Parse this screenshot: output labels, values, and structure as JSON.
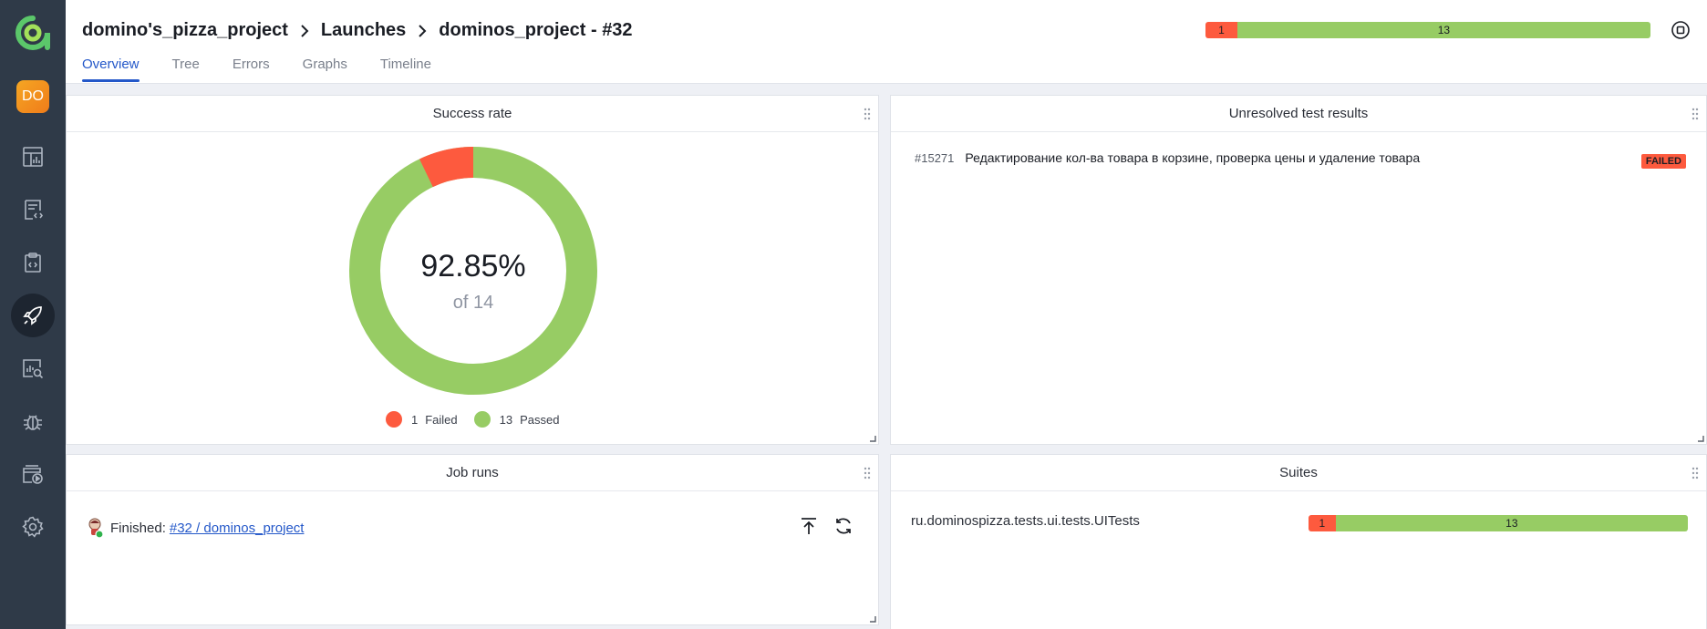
{
  "sidebar": {
    "avatar_initials": "DO",
    "items": [
      {
        "icon": "dashboard-icon",
        "active": false
      },
      {
        "icon": "test-cases-icon",
        "active": false
      },
      {
        "icon": "test-plans-icon",
        "active": false
      },
      {
        "icon": "launches-icon",
        "active": true
      },
      {
        "icon": "analytics-icon",
        "active": false
      },
      {
        "icon": "defects-icon",
        "active": false
      },
      {
        "icon": "jobs-icon",
        "active": false
      },
      {
        "icon": "settings-icon",
        "active": false
      }
    ]
  },
  "header": {
    "breadcrumb": [
      "domino's_pizza_project",
      "Launches",
      "dominos_project - #32"
    ],
    "tabs": [
      "Overview",
      "Tree",
      "Errors",
      "Graphs",
      "Timeline"
    ],
    "active_tab": "Overview",
    "stats": {
      "failed": "1",
      "passed": "13",
      "failed_share": 0.0714
    }
  },
  "colors": {
    "failed": "#fd5a3e",
    "passed": "#97cc64",
    "accent": "#2458c9"
  },
  "success_rate": {
    "title": "Success rate",
    "percent": "92.85%",
    "of_total": "of 14",
    "legend": [
      {
        "count": "1",
        "label": "Failed"
      },
      {
        "count": "13",
        "label": "Passed"
      }
    ]
  },
  "unresolved": {
    "title": "Unresolved test results",
    "items": [
      {
        "id": "#15271",
        "name": "Редактирование кол-ва товара в корзине, проверка цены и удаление товара",
        "status": "FAILED"
      }
    ]
  },
  "job_runs": {
    "title": "Job runs",
    "status_label": "Finished:",
    "link_text": "#32 / dominos_project"
  },
  "suites": {
    "title": "Suites",
    "items": [
      {
        "name": "ru.dominospizza.tests.ui.tests.UITests",
        "failed": "1",
        "passed": "13",
        "failed_share": 0.0714
      }
    ]
  }
}
